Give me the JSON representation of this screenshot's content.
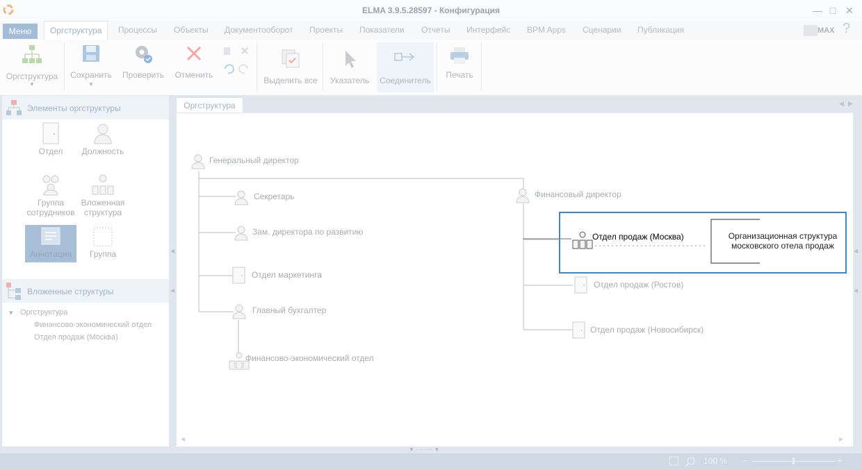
{
  "window": {
    "title": "ELMA 3.9.5.28597 - Конфигурация"
  },
  "menu_button": "Меню",
  "tabs": [
    "Оргструктура",
    "Процессы",
    "Объекты",
    "Документооборот",
    "Проекты",
    "Показатели",
    "Отчеты",
    "Интерфейс",
    "BPM Apps",
    "Сценарии",
    "Публикация"
  ],
  "max_label": "MAX",
  "help": "?",
  "ribbon": {
    "orgstructure": "Оргструктура",
    "save": "Сохранить",
    "check": "Проверить",
    "cancel": "Отменить",
    "select_all": "Выделить все",
    "pointer": "Указатель",
    "connector": "Соединитель",
    "print": "Печать"
  },
  "left": {
    "elements_title": "Элементы оргструктуры",
    "tools": {
      "dept": "Отдел",
      "position": "Должность",
      "group_line1": "Группа",
      "group_line2": "сотрудников",
      "nested_line1": "Вложенная",
      "nested_line2": "структура",
      "annotation": "Аннотация",
      "group": "Группа"
    },
    "nested_title": "Вложенные структуры",
    "tree": {
      "root": "Оргструктура",
      "child1": "Финансово-экономический отдел",
      "child2": "Отдел продаж (Москва)"
    }
  },
  "doc_tab": "Оргструктура",
  "org": {
    "gen_director": "Генеральный директор",
    "secretary": "Секретарь",
    "deputy": "Зам. директора по развитию",
    "marketing": "Отдел маркетинга",
    "accountant": "Главный бухгалтер",
    "fin_econ": "Финансово-экономический отдел",
    "fin_director": "Финансовый директор",
    "sales_moscow": "Отдел продаж (Москва)",
    "annotation_line1": "Организационная структура",
    "annotation_line2": "московского отела продаж",
    "sales_rostov": "Отдел продаж (Ростов)",
    "sales_novosibirsk": "Отдел продаж (Новосибирск)"
  },
  "status": {
    "zoom": "100 %"
  },
  "colors": {
    "highlight": "#3a87c8",
    "menu": "#a3bcd6"
  }
}
